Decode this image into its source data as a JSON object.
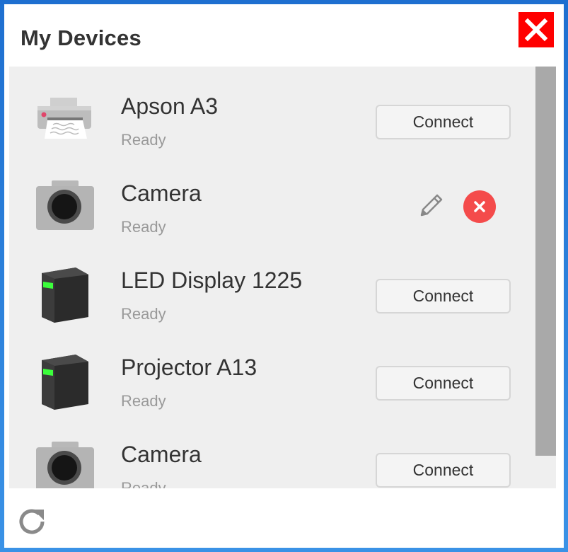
{
  "dialog": {
    "title": "My Devices"
  },
  "devices": [
    {
      "name": "Apson A3",
      "status": "Ready",
      "icon": "printer-icon",
      "action": "Connect"
    },
    {
      "name": "Camera",
      "status": "Ready",
      "icon": "camera-icon",
      "action": ""
    },
    {
      "name": "LED Display 1225",
      "status": "Ready",
      "icon": "display-box-icon",
      "action": "Connect"
    },
    {
      "name": "Projector A13",
      "status": "Ready",
      "icon": "projector-box-icon",
      "action": "Connect"
    },
    {
      "name": "Camera",
      "status": "Ready",
      "icon": "camera-icon",
      "action": "Connect"
    }
  ],
  "colors": {
    "close": "#ff0000",
    "delete": "#f44b4b",
    "led": "#3cff3c",
    "scroll_thumb": "#a9a9a9",
    "list_bg": "#efefef"
  },
  "icons": {
    "close": "close-icon",
    "edit": "pencil-icon",
    "delete": "delete-x-icon",
    "refresh": "refresh-icon"
  }
}
